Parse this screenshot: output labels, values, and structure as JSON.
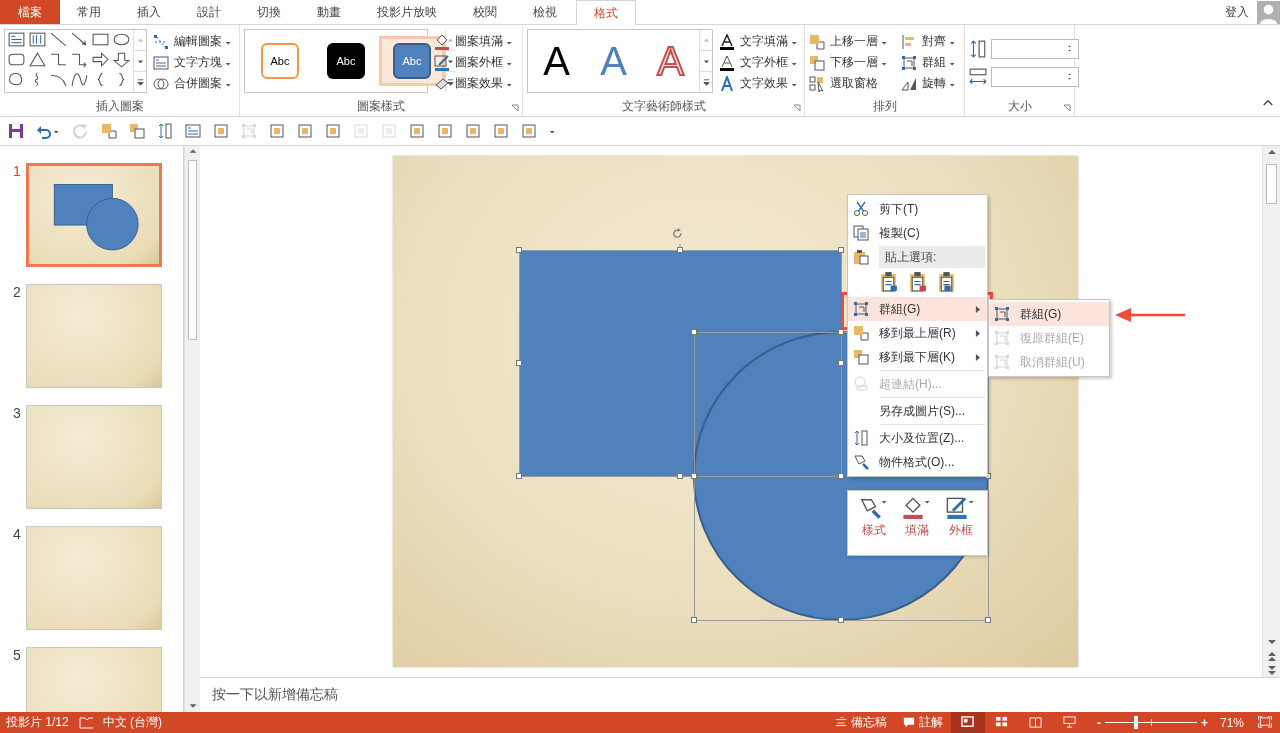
{
  "tabs": [
    {
      "label": "檔案",
      "kind": "file",
      "selected": false
    },
    {
      "label": "常用",
      "kind": "tab",
      "selected": false
    },
    {
      "label": "插入",
      "kind": "tab",
      "selected": false
    },
    {
      "label": "設計",
      "kind": "tab",
      "selected": false
    },
    {
      "label": "切換",
      "kind": "tab",
      "selected": false
    },
    {
      "label": "動畫",
      "kind": "tab",
      "selected": false
    },
    {
      "label": "投影片放映",
      "kind": "tab",
      "selected": false
    },
    {
      "label": "校閱",
      "kind": "tab",
      "selected": false
    },
    {
      "label": "檢視",
      "kind": "tab",
      "selected": false
    },
    {
      "label": "格式",
      "kind": "tab",
      "selected": true
    }
  ],
  "account": {
    "label": "登入"
  },
  "ribbon": {
    "groups": [
      {
        "label": "插入圖案",
        "kind": "shapes",
        "commands": [
          {
            "label": "編輯圖案",
            "dropdown": true
          },
          {
            "label": "文字方塊",
            "dropdown": true
          },
          {
            "label": "合併圖案",
            "dropdown": true
          }
        ]
      },
      {
        "label": "圖案樣式",
        "kind": "styles",
        "presets": [
          {
            "label": "Abc",
            "selected": false
          },
          {
            "label": "Abc",
            "selected": false
          },
          {
            "label": "Abc",
            "selected": true
          }
        ],
        "commands": [
          {
            "label": "圖案填滿",
            "dropdown": true
          },
          {
            "label": "圖案外框",
            "dropdown": true
          },
          {
            "label": "圖案效果",
            "dropdown": true
          }
        ]
      },
      {
        "label": "文字藝術師樣式",
        "kind": "wordart",
        "presets": [
          {
            "label": "A"
          },
          {
            "label": "A"
          },
          {
            "label": "A"
          }
        ],
        "commands": [
          {
            "label": "文字填滿",
            "dropdown": true
          },
          {
            "label": "文字外框",
            "dropdown": true
          },
          {
            "label": "文字效果",
            "dropdown": true
          }
        ]
      },
      {
        "label": "排列",
        "kind": "arrange",
        "commands": [
          {
            "label": "上移一層",
            "dropdown": true
          },
          {
            "label": "對齊",
            "dropdown": true
          },
          {
            "label": "下移一層",
            "dropdown": true
          },
          {
            "label": "群組",
            "dropdown": true
          },
          {
            "label": "選取窗格",
            "dropdown": false
          },
          {
            "label": "旋轉",
            "dropdown": true
          }
        ]
      },
      {
        "label": "大小",
        "kind": "size"
      }
    ]
  },
  "slides": [
    {
      "number": "1",
      "kind": "shapes",
      "selected": true
    },
    {
      "number": "2",
      "kind": "blank",
      "selected": false
    },
    {
      "number": "3",
      "kind": "blank",
      "selected": false
    },
    {
      "number": "4",
      "kind": "blank",
      "selected": false
    },
    {
      "number": "5",
      "kind": "blank",
      "selected": false
    }
  ],
  "context_menu": {
    "items": [
      {
        "kind": "item",
        "label": "剪下(T)",
        "disabled": false,
        "selected": false,
        "submenu": false
      },
      {
        "kind": "item",
        "label": "複製(C)",
        "disabled": false,
        "selected": false,
        "submenu": false
      },
      {
        "kind": "header",
        "label": "貼上選項:"
      },
      {
        "kind": "paste_options"
      },
      {
        "kind": "item",
        "label": "群組(G)",
        "disabled": false,
        "selected": true,
        "submenu": true
      },
      {
        "kind": "item",
        "label": "移到最上層(R)",
        "disabled": false,
        "selected": false,
        "submenu": true
      },
      {
        "kind": "item",
        "label": "移到最下層(K)",
        "disabled": false,
        "selected": false,
        "submenu": true
      },
      {
        "kind": "separator"
      },
      {
        "kind": "item",
        "label": "超連結(H)...",
        "disabled": true,
        "selected": false,
        "submenu": false
      },
      {
        "kind": "separator"
      },
      {
        "kind": "item",
        "label": "另存成圖片(S)...",
        "disabled": false,
        "selected": false,
        "submenu": false
      },
      {
        "kind": "separator"
      },
      {
        "kind": "item",
        "label": "大小及位置(Z)...",
        "disabled": false,
        "selected": false,
        "submenu": false
      },
      {
        "kind": "item",
        "label": "物件格式(O)...",
        "disabled": false,
        "selected": false,
        "submenu": false
      }
    ],
    "submenu": [
      {
        "label": "群組(G)",
        "disabled": false,
        "selected": true
      },
      {
        "label": "復原群組(E)",
        "disabled": true,
        "selected": false
      },
      {
        "label": "取消群組(U)",
        "disabled": true,
        "selected": false
      }
    ]
  },
  "mini_toolbar": [
    {
      "label": "樣式"
    },
    {
      "label": "填滿"
    },
    {
      "label": "外框"
    }
  ],
  "notes": {
    "placeholder": "按一下以新增備忘稿"
  },
  "status_bar": {
    "slide": "投影片 1/12",
    "language": "中文 (台灣)",
    "notes": "備忘稿",
    "comments": "註解",
    "views": [
      {
        "selected": true
      },
      {
        "selected": false
      },
      {
        "selected": false
      },
      {
        "selected": false
      }
    ],
    "zoom_out": "-",
    "zoom_in": "+",
    "zoom": {
      "level": 0.34
    },
    "zoom_percent": "71%"
  }
}
